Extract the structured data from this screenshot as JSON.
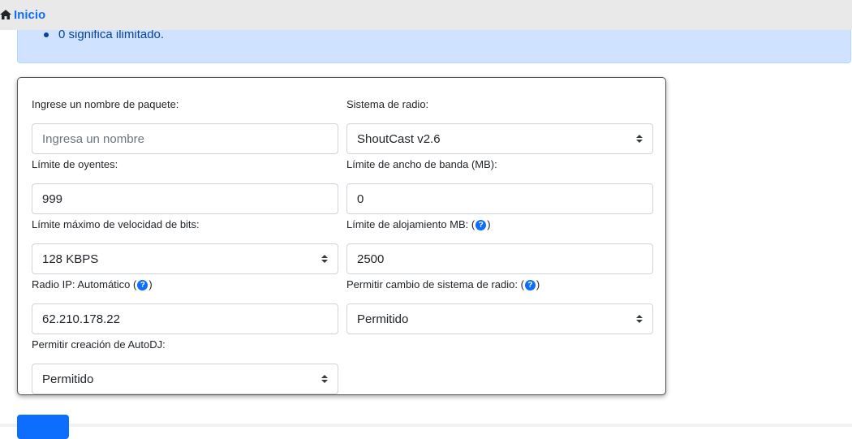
{
  "nav": {
    "home_label": "Inicio"
  },
  "alert": {
    "note": "0 significa ilimitado."
  },
  "form": {
    "package_name": {
      "label": "Ingrese un nombre de paquete:",
      "placeholder": "Ingresa un nombre",
      "value": ""
    },
    "radio_system": {
      "label": "Sistema de radio:",
      "selected": "ShoutCast v2.6"
    },
    "listener_limit": {
      "label": "Límite de oyentes:",
      "value": "999"
    },
    "bandwidth_limit": {
      "label": "Límite de ancho de banda (MB):",
      "value": "0"
    },
    "bitrate_limit": {
      "label": "Límite máximo de velocidad de bits:",
      "selected": "128 KBPS"
    },
    "hosting_limit": {
      "label_text": "Límite de alojamiento MB: (",
      "label_close": ")",
      "value": "2500"
    },
    "radio_ip": {
      "label_text": "Radio IP: Automático (",
      "label_close": ")",
      "value": "62.210.178.22"
    },
    "allow_system_change": {
      "label_text": "Permitir cambio de sistema de radio: (",
      "label_close": ")",
      "selected": "Permitido"
    },
    "allow_autodj": {
      "label": "Permitir creación de AutoDJ:",
      "selected": "Permitido"
    }
  },
  "icons": {
    "home": "home-icon",
    "help": "question-circle-icon",
    "help_glyph": "?"
  },
  "colors": {
    "primary": "#0d6efd",
    "alert_bg": "#cfe2ff",
    "alert_text": "#084298",
    "topbar": "#e9e9e9"
  }
}
